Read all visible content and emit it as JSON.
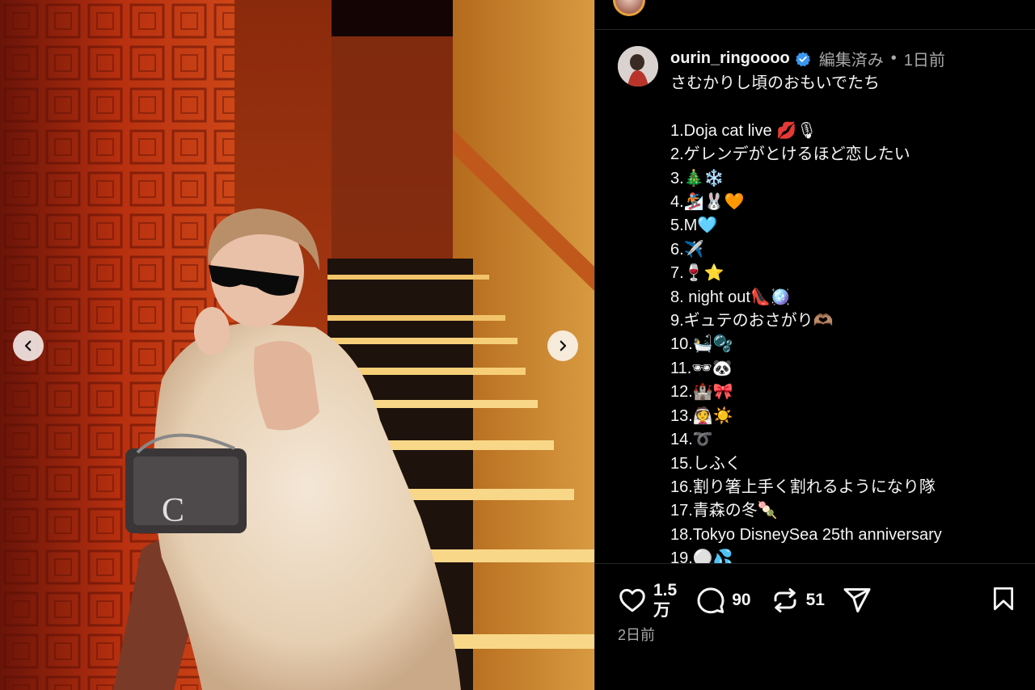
{
  "post": {
    "username": "ourin_ringoooo",
    "edited": "編集済み",
    "separator": "•",
    "time": "1日前",
    "caption": "さむかりし頃のおもいでたち\n\n1.Doja cat live 💋🎙\n2.ゲレンデがとけるほど恋したい\n3.🎄❄️\n4.🏂🐰🧡\n5.M🩵\n6.✈️\n7.🍷⭐️\n8. night out👠🪩\n9.ギュテのおさがり🫶🏽\n10.🛀🫧\n11.🕶🐼\n12.🏰🎀\n13.👰☀️\n14.➰\n15.しふく\n16.割り箸上手く割れるようになり隊\n17.青森の冬🍡\n18.Tokyo DisneySea 25th anniversary\n19.⚪️💦"
  },
  "stats": {
    "likes_line1": "1.5",
    "likes_line2": "万",
    "comments": "90",
    "reposts": "51"
  },
  "date": "2日前",
  "icons": {
    "prev": "chevron-left-icon",
    "next": "chevron-right-icon",
    "like": "heart-icon",
    "comment": "comment-icon",
    "repost": "repost-icon",
    "share": "share-icon",
    "save": "bookmark-icon"
  },
  "colors": {
    "verified": "#3897f0",
    "background": "#000000",
    "muted_text": "#a8a8a8"
  }
}
